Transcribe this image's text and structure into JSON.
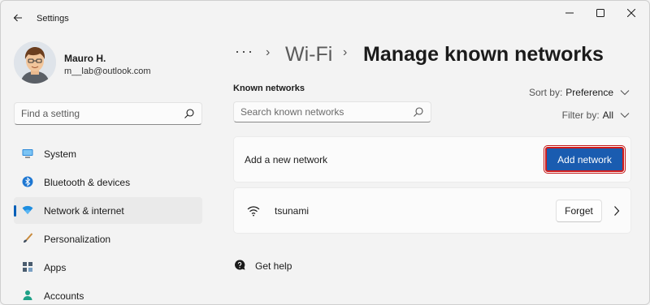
{
  "window": {
    "title": "Settings"
  },
  "user": {
    "name": "Mauro H.",
    "email": "m__lab@outlook.com"
  },
  "sidebar": {
    "search_placeholder": "Find a setting",
    "items": [
      {
        "label": "System",
        "icon": "monitor-icon"
      },
      {
        "label": "Bluetooth & devices",
        "icon": "bluetooth-icon"
      },
      {
        "label": "Network & internet",
        "icon": "network-icon",
        "active": true
      },
      {
        "label": "Personalization",
        "icon": "brush-icon"
      },
      {
        "label": "Apps",
        "icon": "apps-icon"
      },
      {
        "label": "Accounts",
        "icon": "person-icon"
      }
    ]
  },
  "breadcrumb": {
    "more": "···",
    "parent": "Wi-Fi",
    "current": "Manage known networks"
  },
  "known_networks": {
    "title": "Known networks",
    "search_placeholder": "Search known networks",
    "sort_label": "Sort by:",
    "sort_value": "Preference",
    "filter_label": "Filter by:",
    "filter_value": "All"
  },
  "add_network": {
    "label": "Add a new network",
    "button": "Add network"
  },
  "networks": [
    {
      "name": "tsunami",
      "forget": "Forget"
    }
  ],
  "help": {
    "label": "Get help"
  },
  "colors": {
    "accent": "#005fb8",
    "button": "#1a5cb0",
    "highlight": "#d21a1a"
  }
}
